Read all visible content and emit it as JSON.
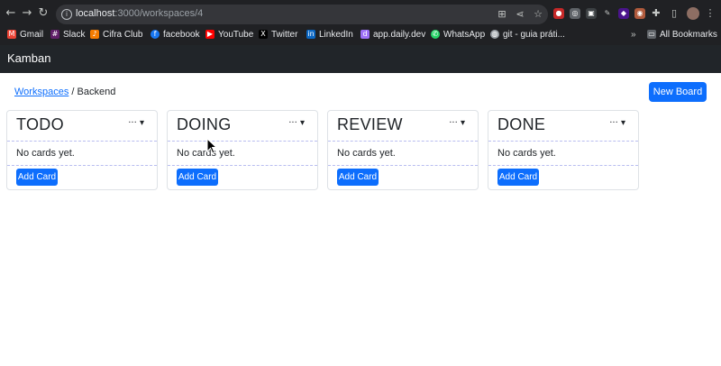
{
  "browser": {
    "url_host": "localhost",
    "url_path": ":3000/workspaces/4",
    "bookmarks": [
      {
        "label": "Gmail",
        "icon": "gmail-icon",
        "color": "#ea4335"
      },
      {
        "label": "Slack",
        "icon": "slack-icon",
        "color": "#611f69"
      },
      {
        "label": "Cifra Club",
        "icon": "cifra-club-icon",
        "color": "#f57c00"
      },
      {
        "label": "facebook",
        "icon": "facebook-icon",
        "color": "#1877f2"
      },
      {
        "label": "YouTube",
        "icon": "youtube-icon",
        "color": "#ff0000"
      },
      {
        "label": "Twitter",
        "icon": "x-icon",
        "color": "#000000"
      },
      {
        "label": "LinkedIn",
        "icon": "linkedin-icon",
        "color": "#0a66c2"
      },
      {
        "label": "app.daily.dev",
        "icon": "daily-dev-icon",
        "color": "#9d70f8"
      },
      {
        "label": "WhatsApp",
        "icon": "whatsapp-icon",
        "color": "#25d366"
      },
      {
        "label": "git - guia práti...",
        "icon": "globe-icon",
        "color": "#9aa0a6"
      }
    ],
    "all_bookmarks": "All Bookmarks"
  },
  "navbar": {
    "brand": "Kamban"
  },
  "breadcrumb": {
    "parent": "Workspaces",
    "separator": "/",
    "current": "Backend"
  },
  "new_board_label": "New Board",
  "columns": [
    {
      "title": "TODO",
      "empty_text": "No cards yet.",
      "add_label": "Add Card",
      "menu": "···"
    },
    {
      "title": "DOING",
      "empty_text": "No cards yet.",
      "add_label": "Add Card",
      "menu": "···"
    },
    {
      "title": "REVIEW",
      "empty_text": "No cards yet.",
      "add_label": "Add Card",
      "menu": "···"
    },
    {
      "title": "DONE",
      "empty_text": "No cards yet.",
      "add_label": "Add Card",
      "menu": "···"
    }
  ],
  "colors": {
    "primary": "#0d6efd",
    "navbar": "#212529",
    "chrome": "#202124"
  }
}
